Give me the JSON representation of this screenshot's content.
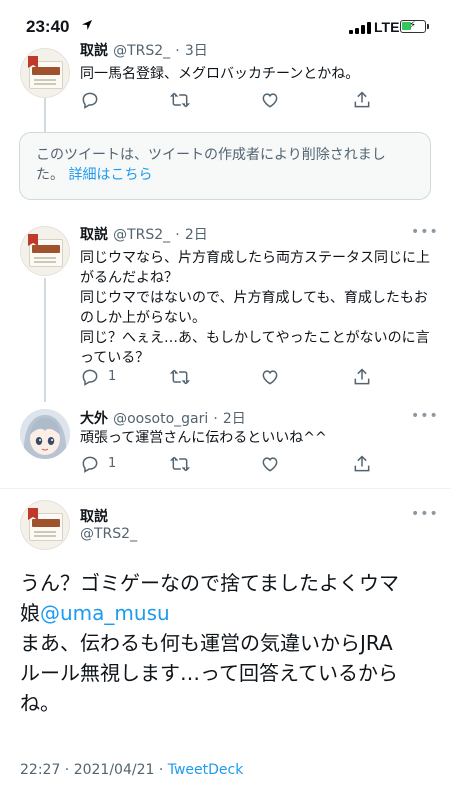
{
  "status_bar": {
    "time": "23:40",
    "network": "LTE"
  },
  "tweets": [
    {
      "name": "取説",
      "handle": "@TRS2_",
      "date": "3日",
      "text": "同一馬名登録、メグロバッカチーンとかね。",
      "reply_count": "",
      "avatar_text": "取扱説明書"
    },
    {
      "name": "取説",
      "handle": "@TRS2_",
      "date": "2日",
      "text_lines": [
        "同じウマなら、片方育成したら両方ステータス同じに上",
        "がるんだよね？",
        "同じウマではないので、片方育成しても、育成したもお",
        "のしか上がらない。",
        "同じ？へぇえ…あ、もしかしてやったことがないのに言",
        "っている？"
      ],
      "reply_count": "1",
      "avatar_text": "取扱説明書"
    },
    {
      "name": "大外",
      "handle": "@oosoto_gari",
      "date": "2日",
      "text": "頑張って運営さんに伝わるといいね^^",
      "reply_count": "1"
    }
  ],
  "deleted_notice": {
    "text_lines": [
      "このツイートは、ツイートの作成者により削除されまし",
      "た。"
    ],
    "link": "詳細はこちら"
  },
  "main_tweet": {
    "name": "取説",
    "handle": "@TRS2_",
    "avatar_text": "取扱説明書",
    "line1": "うん？ゴミゲーなので捨てましたよくウマ",
    "line2_prefix": "娘",
    "mention": "@uma_musu",
    "line3": "まあ、伝わるも何も運営の気違いからJRA",
    "line4": "ルール無視します…って回答えているから",
    "line5": "ね。",
    "timestamp": "22:27 · 2021/04/21 · ",
    "source": "TweetDeck"
  },
  "dot": "·",
  "more_glyph": "•••",
  "colors": {
    "accent": "#1d9bf0",
    "muted": "#536471",
    "border": "#cfd9de"
  },
  "icons": [
    "reply-icon",
    "retweet-icon",
    "like-icon",
    "share-icon",
    "location-arrow-icon"
  ]
}
